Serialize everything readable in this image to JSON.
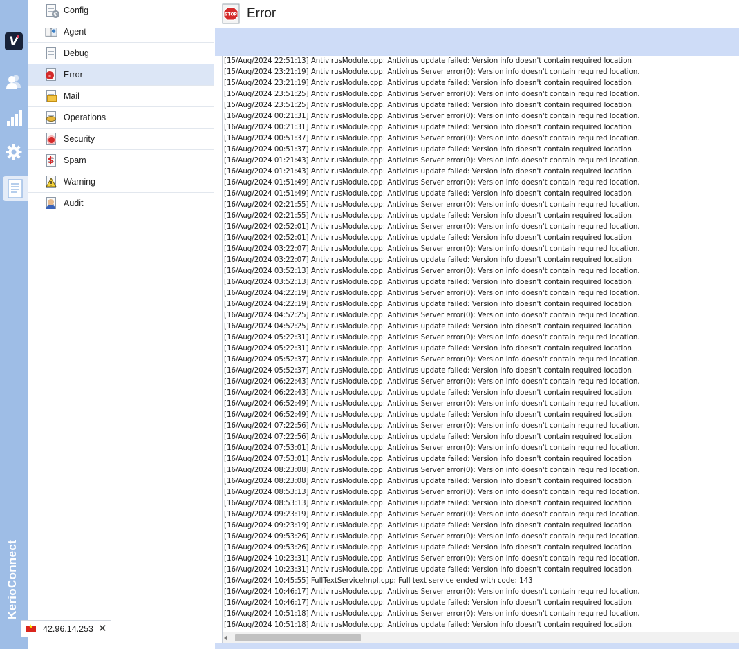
{
  "brand": "KerioConnect",
  "rail": [
    {
      "name": "logo-icon"
    },
    {
      "name": "users-icon"
    },
    {
      "name": "statistics-icon"
    },
    {
      "name": "settings-icon"
    },
    {
      "name": "logs-icon",
      "active": true
    }
  ],
  "log_list": [
    {
      "label": "Config",
      "icon": "config-log-icon"
    },
    {
      "label": "Agent",
      "icon": "agent-log-icon"
    },
    {
      "label": "Debug",
      "icon": "debug-log-icon"
    },
    {
      "label": "Error",
      "icon": "error-log-icon",
      "selected": true
    },
    {
      "label": "Mail",
      "icon": "mail-log-icon"
    },
    {
      "label": "Operations",
      "icon": "operations-log-icon"
    },
    {
      "label": "Security",
      "icon": "security-log-icon"
    },
    {
      "label": "Spam",
      "icon": "spam-log-icon"
    },
    {
      "label": "Warning",
      "icon": "warning-log-icon"
    },
    {
      "label": "Audit",
      "icon": "audit-log-icon"
    }
  ],
  "ip_widget": {
    "ip": "42.96.14.253",
    "flag": "vietnam-flag-icon"
  },
  "main": {
    "title": "Error",
    "title_icon": "stop-sign-icon"
  },
  "log_lines": [
    "[15/Aug/2024 22:51:13] AntivirusModule.cpp: Antivirus update failed: Version info doesn't contain required location.",
    "[15/Aug/2024 23:21:19] AntivirusModule.cpp: Antivirus Server error(0): Version info doesn't contain required location.",
    "[15/Aug/2024 23:21:19] AntivirusModule.cpp: Antivirus update failed: Version info doesn't contain required location.",
    "[15/Aug/2024 23:51:25] AntivirusModule.cpp: Antivirus Server error(0): Version info doesn't contain required location.",
    "[15/Aug/2024 23:51:25] AntivirusModule.cpp: Antivirus update failed: Version info doesn't contain required location.",
    "[16/Aug/2024 00:21:31] AntivirusModule.cpp: Antivirus Server error(0): Version info doesn't contain required location.",
    "[16/Aug/2024 00:21:31] AntivirusModule.cpp: Antivirus update failed: Version info doesn't contain required location.",
    "[16/Aug/2024 00:51:37] AntivirusModule.cpp: Antivirus Server error(0): Version info doesn't contain required location.",
    "[16/Aug/2024 00:51:37] AntivirusModule.cpp: Antivirus update failed: Version info doesn't contain required location.",
    "[16/Aug/2024 01:21:43] AntivirusModule.cpp: Antivirus Server error(0): Version info doesn't contain required location.",
    "[16/Aug/2024 01:21:43] AntivirusModule.cpp: Antivirus update failed: Version info doesn't contain required location.",
    "[16/Aug/2024 01:51:49] AntivirusModule.cpp: Antivirus Server error(0): Version info doesn't contain required location.",
    "[16/Aug/2024 01:51:49] AntivirusModule.cpp: Antivirus update failed: Version info doesn't contain required location.",
    "[16/Aug/2024 02:21:55] AntivirusModule.cpp: Antivirus Server error(0): Version info doesn't contain required location.",
    "[16/Aug/2024 02:21:55] AntivirusModule.cpp: Antivirus update failed: Version info doesn't contain required location.",
    "[16/Aug/2024 02:52:01] AntivirusModule.cpp: Antivirus Server error(0): Version info doesn't contain required location.",
    "[16/Aug/2024 02:52:01] AntivirusModule.cpp: Antivirus update failed: Version info doesn't contain required location.",
    "[16/Aug/2024 03:22:07] AntivirusModule.cpp: Antivirus Server error(0): Version info doesn't contain required location.",
    "[16/Aug/2024 03:22:07] AntivirusModule.cpp: Antivirus update failed: Version info doesn't contain required location.",
    "[16/Aug/2024 03:52:13] AntivirusModule.cpp: Antivirus Server error(0): Version info doesn't contain required location.",
    "[16/Aug/2024 03:52:13] AntivirusModule.cpp: Antivirus update failed: Version info doesn't contain required location.",
    "[16/Aug/2024 04:22:19] AntivirusModule.cpp: Antivirus Server error(0): Version info doesn't contain required location.",
    "[16/Aug/2024 04:22:19] AntivirusModule.cpp: Antivirus update failed: Version info doesn't contain required location.",
    "[16/Aug/2024 04:52:25] AntivirusModule.cpp: Antivirus Server error(0): Version info doesn't contain required location.",
    "[16/Aug/2024 04:52:25] AntivirusModule.cpp: Antivirus update failed: Version info doesn't contain required location.",
    "[16/Aug/2024 05:22:31] AntivirusModule.cpp: Antivirus Server error(0): Version info doesn't contain required location.",
    "[16/Aug/2024 05:22:31] AntivirusModule.cpp: Antivirus update failed: Version info doesn't contain required location.",
    "[16/Aug/2024 05:52:37] AntivirusModule.cpp: Antivirus Server error(0): Version info doesn't contain required location.",
    "[16/Aug/2024 05:52:37] AntivirusModule.cpp: Antivirus update failed: Version info doesn't contain required location.",
    "[16/Aug/2024 06:22:43] AntivirusModule.cpp: Antivirus Server error(0): Version info doesn't contain required location.",
    "[16/Aug/2024 06:22:43] AntivirusModule.cpp: Antivirus update failed: Version info doesn't contain required location.",
    "[16/Aug/2024 06:52:49] AntivirusModule.cpp: Antivirus Server error(0): Version info doesn't contain required location.",
    "[16/Aug/2024 06:52:49] AntivirusModule.cpp: Antivirus update failed: Version info doesn't contain required location.",
    "[16/Aug/2024 07:22:56] AntivirusModule.cpp: Antivirus Server error(0): Version info doesn't contain required location.",
    "[16/Aug/2024 07:22:56] AntivirusModule.cpp: Antivirus update failed: Version info doesn't contain required location.",
    "[16/Aug/2024 07:53:01] AntivirusModule.cpp: Antivirus Server error(0): Version info doesn't contain required location.",
    "[16/Aug/2024 07:53:01] AntivirusModule.cpp: Antivirus update failed: Version info doesn't contain required location.",
    "[16/Aug/2024 08:23:08] AntivirusModule.cpp: Antivirus Server error(0): Version info doesn't contain required location.",
    "[16/Aug/2024 08:23:08] AntivirusModule.cpp: Antivirus update failed: Version info doesn't contain required location.",
    "[16/Aug/2024 08:53:13] AntivirusModule.cpp: Antivirus Server error(0): Version info doesn't contain required location.",
    "[16/Aug/2024 08:53:13] AntivirusModule.cpp: Antivirus update failed: Version info doesn't contain required location.",
    "[16/Aug/2024 09:23:19] AntivirusModule.cpp: Antivirus Server error(0): Version info doesn't contain required location.",
    "[16/Aug/2024 09:23:19] AntivirusModule.cpp: Antivirus update failed: Version info doesn't contain required location.",
    "[16/Aug/2024 09:53:26] AntivirusModule.cpp: Antivirus Server error(0): Version info doesn't contain required location.",
    "[16/Aug/2024 09:53:26] AntivirusModule.cpp: Antivirus update failed: Version info doesn't contain required location.",
    "[16/Aug/2024 10:23:31] AntivirusModule.cpp: Antivirus Server error(0): Version info doesn't contain required location.",
    "[16/Aug/2024 10:23:31] AntivirusModule.cpp: Antivirus update failed: Version info doesn't contain required location.",
    "[16/Aug/2024 10:45:55] FullTextServiceImpl.cpp: Full text service ended with code: 143",
    "[16/Aug/2024 10:46:17] AntivirusModule.cpp: Antivirus Server error(0): Version info doesn't contain required location.",
    "[16/Aug/2024 10:46:17] AntivirusModule.cpp: Antivirus update failed: Version info doesn't contain required location.",
    "[16/Aug/2024 10:51:18] AntivirusModule.cpp: Antivirus Server error(0): Version info doesn't contain required location.",
    "[16/Aug/2024 10:51:18] AntivirusModule.cpp: Antivirus update failed: Version info doesn't contain required location."
  ],
  "colors": {
    "rail_bg": "#9ebde6",
    "toolbar_bg": "#cedcf7",
    "selected_row": "#dce6f6",
    "brand_dark": "#182238",
    "brand_accent": "#e23b5a",
    "stop_red": "#d42a2a"
  }
}
